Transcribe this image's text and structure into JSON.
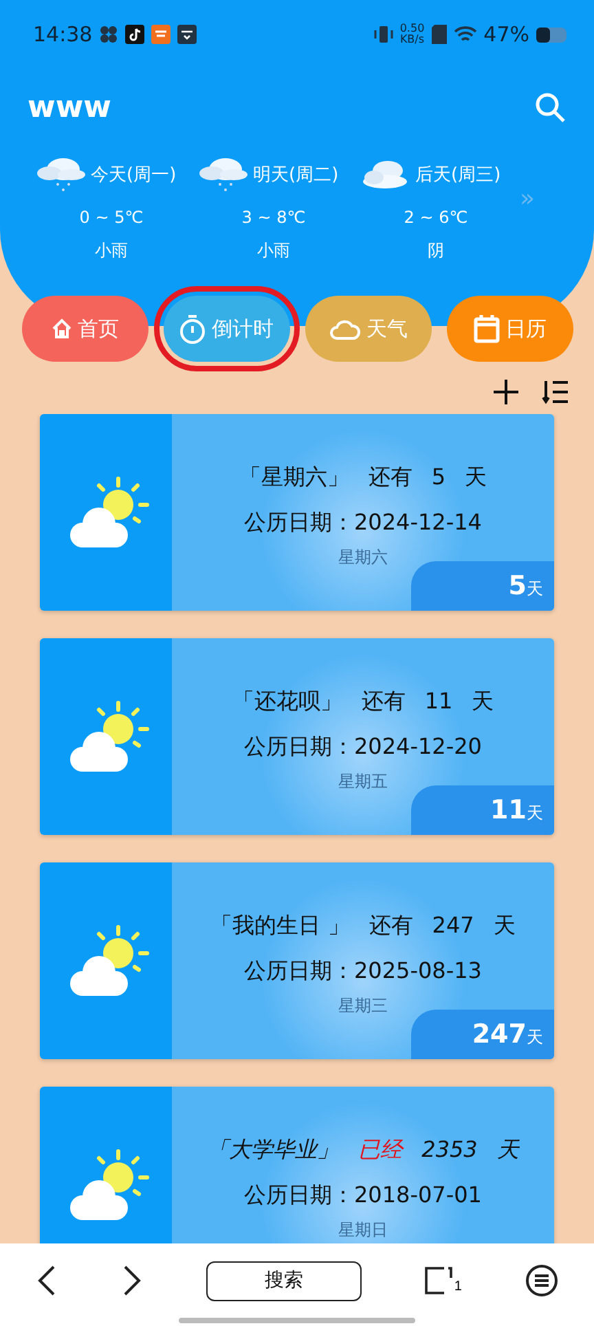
{
  "status_bar": {
    "time": "14:38",
    "speed_value": "0.50",
    "speed_unit": "KB/s",
    "battery": "47%"
  },
  "header": {
    "title": "www"
  },
  "forecast": [
    {
      "day": "今天(周一)",
      "temp": "0 ~ 5℃",
      "condition": "小雨",
      "kind": "rain"
    },
    {
      "day": "明天(周二)",
      "temp": "3 ~ 8℃",
      "condition": "小雨",
      "kind": "rain"
    },
    {
      "day": "后天(周三)",
      "temp": "2 ~ 6℃",
      "condition": "阴",
      "kind": "cloudy"
    }
  ],
  "forecast_more": "»",
  "nav": [
    {
      "label": "首页",
      "kind": "home",
      "color": "#f4645a",
      "highlighted": false
    },
    {
      "label": "倒计时",
      "kind": "timer",
      "color": "#36aee6",
      "highlighted": true
    },
    {
      "label": "天气",
      "kind": "weather",
      "color": "#dfae4e",
      "highlighted": false
    },
    {
      "label": "日历",
      "kind": "calendar",
      "color": "#fb8a0b",
      "highlighted": false
    }
  ],
  "events": [
    {
      "kind": "future",
      "name": "「星期六」",
      "verb": "还有",
      "count": "5",
      "unit": "天",
      "date_label": "公历日期：",
      "date": "2024-12-14",
      "weekday": "星期六",
      "badge_number": "5",
      "badge_unit": "天"
    },
    {
      "kind": "future",
      "name": "「还花呗」",
      "verb": "还有",
      "count": "11",
      "unit": "天",
      "date_label": "公历日期：",
      "date": "2024-12-20",
      "weekday": "星期五",
      "badge_number": "11",
      "badge_unit": "天"
    },
    {
      "kind": "future",
      "name": "「我的生日 」",
      "verb": "还有",
      "count": "247",
      "unit": "天",
      "date_label": "公历日期：",
      "date": "2025-08-13",
      "weekday": "星期三",
      "badge_number": "247",
      "badge_unit": "天"
    },
    {
      "kind": "past",
      "name": "「大学毕业」",
      "verb": "已经",
      "count": "2353",
      "unit": "天",
      "date_label": "公历日期：",
      "date": "2018-07-01",
      "weekday": "星期日"
    }
  ],
  "browser_bar": {
    "search_label": "搜索",
    "tab_count": "1"
  }
}
